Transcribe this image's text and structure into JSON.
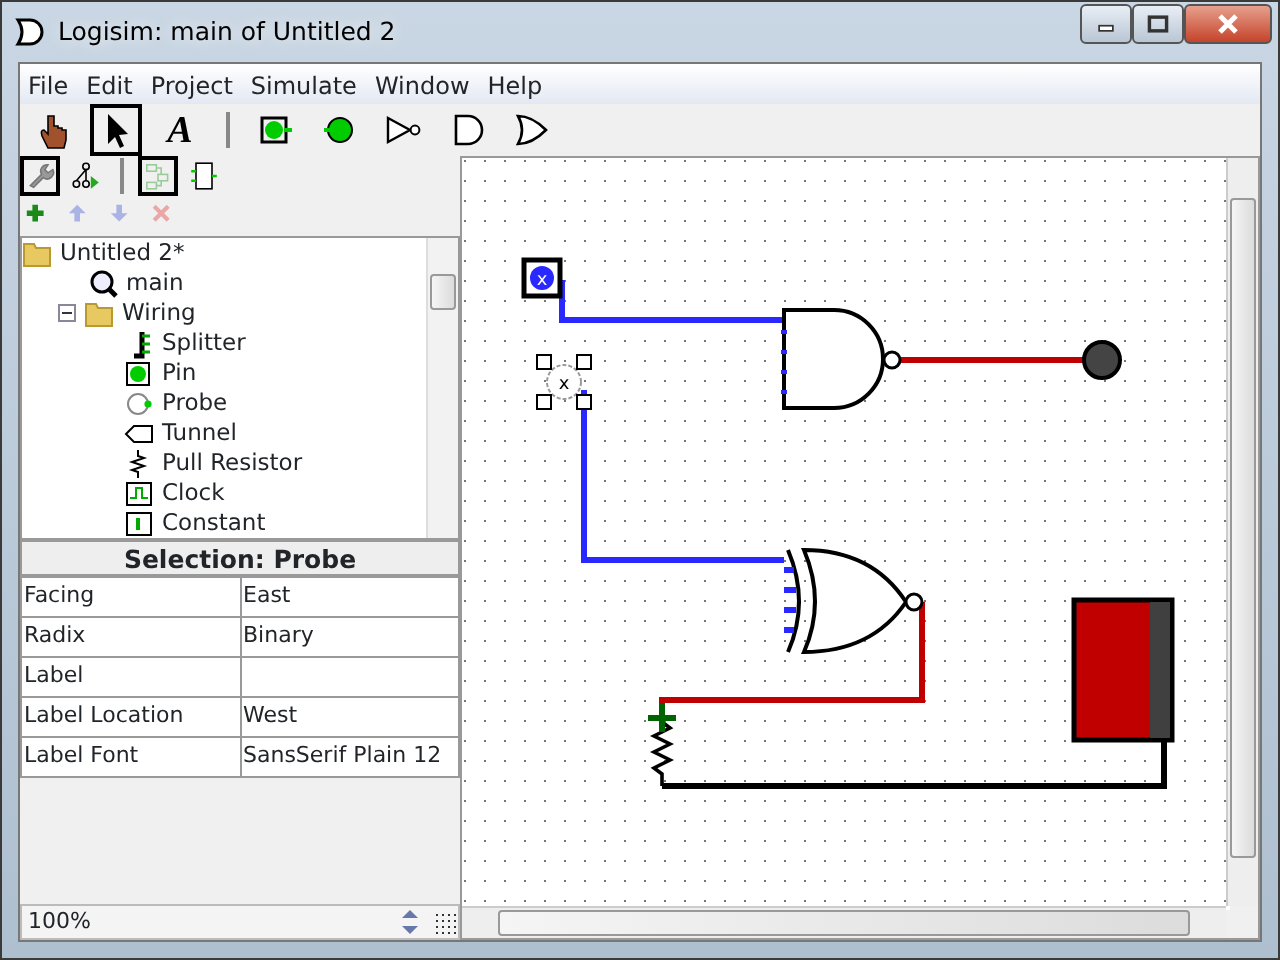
{
  "window": {
    "title": "Logisim: main of Untitled 2"
  },
  "menu": [
    "File",
    "Edit",
    "Project",
    "Simulate",
    "Window",
    "Help"
  ],
  "toolbar": [
    {
      "kind": "poke",
      "selected": false
    },
    {
      "kind": "select",
      "selected": true
    },
    {
      "kind": "text",
      "label": "A",
      "selected": false
    },
    {
      "kind": "separator"
    },
    {
      "kind": "input_pin",
      "selected": false
    },
    {
      "kind": "output_pin",
      "selected": false
    },
    {
      "kind": "not_gate",
      "selected": false
    },
    {
      "kind": "and_gate",
      "selected": false
    },
    {
      "kind": "or_gate",
      "selected": false
    }
  ],
  "view_toolbar": [
    {
      "kind": "properties",
      "selected": true
    },
    {
      "kind": "simulation",
      "selected": false
    },
    {
      "kind": "separator"
    },
    {
      "kind": "layout",
      "selected": true
    },
    {
      "kind": "appearance",
      "selected": false
    }
  ],
  "project_toolbar": [
    {
      "kind": "add",
      "disabled": false
    },
    {
      "kind": "up",
      "disabled": true
    },
    {
      "kind": "down",
      "disabled": true
    },
    {
      "kind": "delete",
      "disabled": true
    }
  ],
  "tree": [
    {
      "label": "Untitled 2*",
      "kind": "folder",
      "children": [
        {
          "label": "main",
          "kind": "circuit"
        },
        {
          "label": "Wiring",
          "kind": "folder",
          "expanded": true,
          "children": [
            {
              "label": "Splitter",
              "kind": "splitter"
            },
            {
              "label": "Pin",
              "kind": "pin"
            },
            {
              "label": "Probe",
              "kind": "probe"
            },
            {
              "label": "Tunnel",
              "kind": "tunnel"
            },
            {
              "label": "Pull Resistor",
              "kind": "resistor"
            },
            {
              "label": "Clock",
              "kind": "clock"
            },
            {
              "label": "Constant",
              "kind": "constant"
            }
          ]
        }
      ]
    }
  ],
  "properties": {
    "title": "Selection: Probe",
    "rows": [
      {
        "name": "Facing",
        "value": "East"
      },
      {
        "name": "Radix",
        "value": "Binary"
      },
      {
        "name": "Label",
        "value": ""
      },
      {
        "name": "Label Location",
        "value": "West"
      },
      {
        "name": "Label Font",
        "value": "SansSerif Plain 12"
      }
    ]
  },
  "zoom": "100%",
  "canvas": {
    "components": [
      {
        "kind": "pin",
        "value": "x"
      },
      {
        "kind": "nand_gate"
      },
      {
        "kind": "led",
        "on": false
      },
      {
        "kind": "probe",
        "value": "x",
        "selected": true
      },
      {
        "kind": "xnor_gate"
      },
      {
        "kind": "pull_resistor"
      },
      {
        "kind": "display"
      }
    ]
  }
}
